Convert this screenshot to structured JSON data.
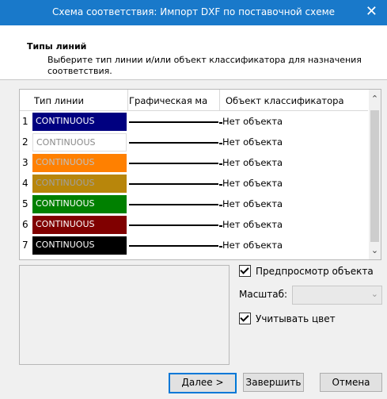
{
  "window": {
    "title": "Схема соответствия: Импорт DXF по поставочной схеме",
    "close_glyph": "✕"
  },
  "header": {
    "title": "Типы линий",
    "description": "Выберите тип линии и/или объект классификатора для назначения соответствия."
  },
  "grid": {
    "columns": [
      "Тип линии",
      "Графическая ма",
      "Объект классификатора"
    ],
    "rows": [
      {
        "num": "1",
        "line_type": "CONTINUOUS",
        "bg": "#000080",
        "fg": "#ffffff",
        "object": "Нет объекта"
      },
      {
        "num": "2",
        "line_type": "CONTINUOUS",
        "bg": "#ffffff",
        "fg": "#8a8a8a",
        "object": "Нет объекта"
      },
      {
        "num": "3",
        "line_type": "CONTINUOUS",
        "bg": "#ff8000",
        "fg": "#c0c0c0",
        "object": "Нет объекта"
      },
      {
        "num": "4",
        "line_type": "CONTINUOUS",
        "bg": "#b8860b",
        "fg": "#a0a0a0",
        "object": "Нет объекта"
      },
      {
        "num": "5",
        "line_type": "CONTINUOUS",
        "bg": "#008000",
        "fg": "#ffffff",
        "object": "Нет объекта"
      },
      {
        "num": "6",
        "line_type": "CONTINUOUS",
        "bg": "#800000",
        "fg": "#ffffff",
        "object": "Нет объекта"
      },
      {
        "num": "7",
        "line_type": "CONTINUOUS",
        "bg": "#000000",
        "fg": "#ffffff",
        "object": "Нет объекта"
      }
    ]
  },
  "options": {
    "preview_label": "Предпросмотр объекта",
    "preview_checked": true,
    "scale_label": "Масштаб:",
    "scale_value": "",
    "use_color_label": "Учитывать цвет",
    "use_color_checked": true
  },
  "buttons": {
    "next": "Далее >",
    "finish": "Завершить",
    "cancel": "Отмена"
  }
}
